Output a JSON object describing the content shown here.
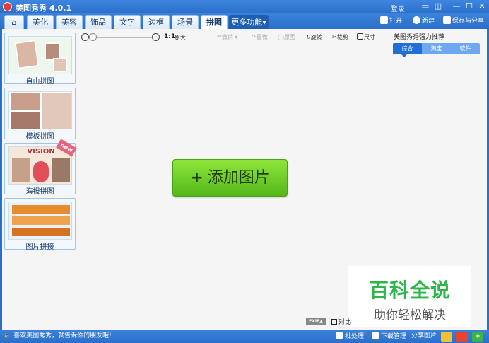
{
  "app": {
    "title": "美图秀秀 4.0.1",
    "login": "登录"
  },
  "tabs": [
    {
      "label": "⌂",
      "name": "home"
    },
    {
      "label": "美化",
      "name": "beautify"
    },
    {
      "label": "美容",
      "name": "beauty"
    },
    {
      "label": "饰品",
      "name": "accessories"
    },
    {
      "label": "文字",
      "name": "text"
    },
    {
      "label": "边框",
      "name": "border"
    },
    {
      "label": "场景",
      "name": "scene"
    },
    {
      "label": "拼图",
      "name": "collage",
      "active": true
    },
    {
      "label": "更多功能▾",
      "name": "more"
    }
  ],
  "toolbar": {
    "open": "打开",
    "new": "新建",
    "save": "保存与分享"
  },
  "sidebar": {
    "items": [
      {
        "label": "自由拼图"
      },
      {
        "label": "模板拼图"
      },
      {
        "label": "海报拼图",
        "badge": "new",
        "poster_text": "VISION"
      },
      {
        "label": "图片拼接"
      }
    ]
  },
  "canvas_tools": {
    "one_to_one": "1:1",
    "original": "原大",
    "undo": "撤销",
    "redo": "重做",
    "restore": "原图",
    "rotate": "旋转",
    "crop": "裁剪",
    "size": "尺寸"
  },
  "recommend": {
    "title": "美图秀秀强力推荐",
    "tabs": [
      "综合",
      "淘宝",
      "软件"
    ]
  },
  "add_button": {
    "plus": "+",
    "label": "添加图片"
  },
  "watermark": {
    "big": "百科全说",
    "small": "助你轻松解决"
  },
  "bottom": {
    "exif": "EXIF▲",
    "compare": "对比"
  },
  "statusbar": {
    "share_text": "喜欢美图秀秀，就告诉你的朋友哦!",
    "batch": "批处理",
    "download": "下载管理",
    "share_pic": "分享图片"
  },
  "colors": {
    "accent_blue": "#2a6fc9",
    "add_green": "#55b71a",
    "watermark_green": "#2cb74a",
    "new_badge": "#e8637c"
  }
}
